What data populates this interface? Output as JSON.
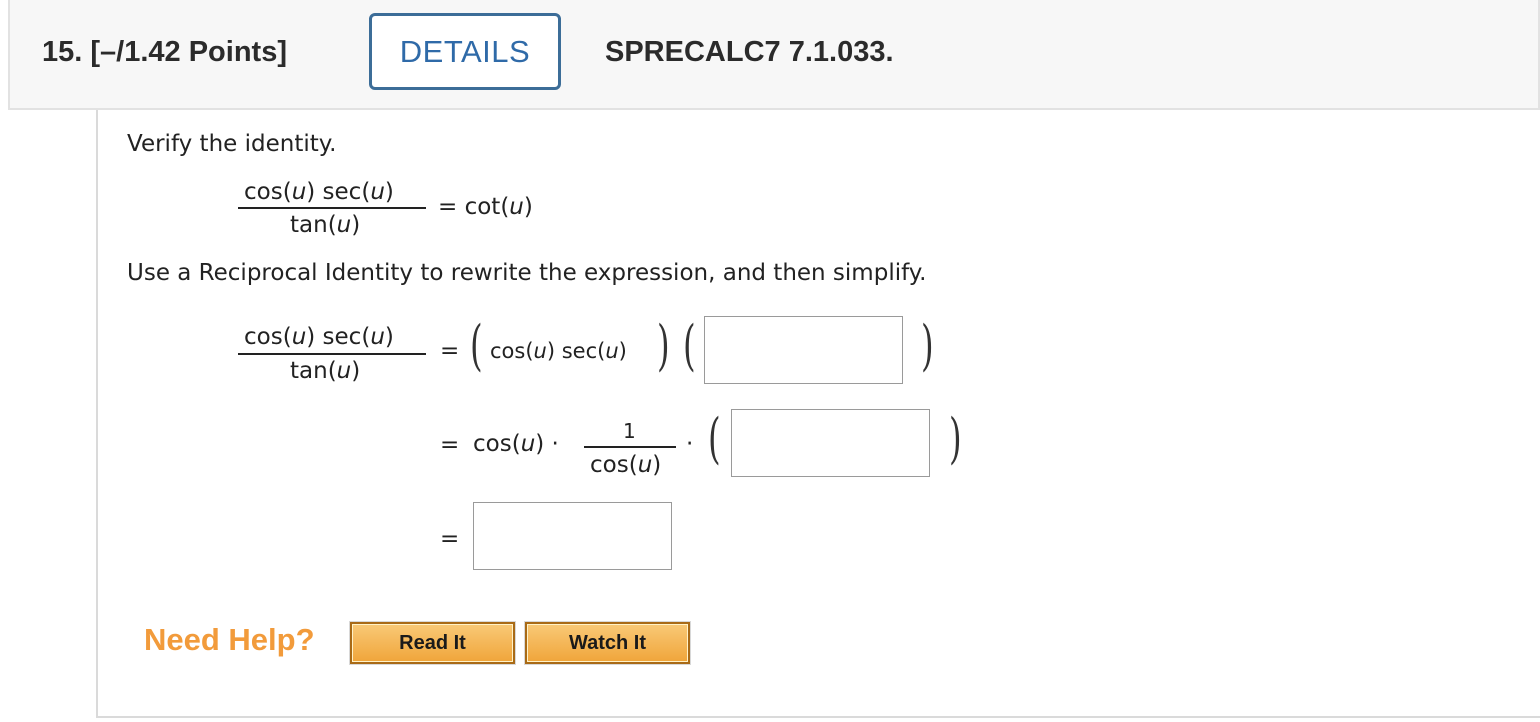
{
  "header": {
    "question_label": "15.  [–/1.42 Points]",
    "details_label": "DETAILS",
    "problem_code": "SPRECALC7 7.1.033."
  },
  "problem": {
    "instruction": "Verify the identity.",
    "identity_numerator": "cos(u) sec(u)",
    "identity_denominator": "tan(u)",
    "identity_rhs": "= cot(u)",
    "step_instruction": "Use a Reciprocal Identity to rewrite the expression, and then simplify.",
    "line1_numerator": "cos(u) sec(u)",
    "line1_denominator": "tan(u)",
    "line1_eq": "=",
    "line1_factor": "cos(u) sec(u)",
    "line2_eq": "=",
    "line2_cos": "cos(u) ·",
    "line2_frac_num": "1",
    "line2_frac_den": "cos(u)",
    "line2_dot": "·",
    "line3_eq": "=",
    "answer_boxes": [
      "",
      "",
      ""
    ]
  },
  "help": {
    "label": "Need Help?",
    "read_it": "Read It",
    "watch_it": "Watch It"
  }
}
